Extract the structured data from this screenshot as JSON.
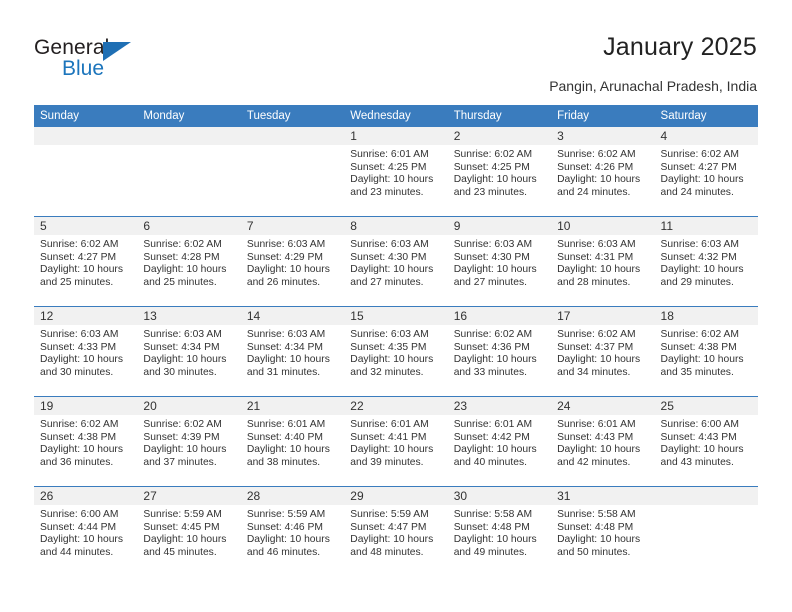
{
  "brand": {
    "name_top": "General",
    "name_bottom": "Blue",
    "accent_color": "#1c75bc",
    "triangle_color": "#1f6fb4"
  },
  "header": {
    "title": "January 2025",
    "subtitle": "Pangin, Arunachal Pradesh, India"
  },
  "calendar": {
    "header_bg": "#3a7cbe",
    "daynum_bg": "#f1f1f1",
    "weekdays": [
      "Sunday",
      "Monday",
      "Tuesday",
      "Wednesday",
      "Thursday",
      "Friday",
      "Saturday"
    ],
    "weeks": [
      [
        {
          "day": "",
          "sunrise": "",
          "sunset": "",
          "daylight1": "",
          "daylight2": ""
        },
        {
          "day": "",
          "sunrise": "",
          "sunset": "",
          "daylight1": "",
          "daylight2": ""
        },
        {
          "day": "",
          "sunrise": "",
          "sunset": "",
          "daylight1": "",
          "daylight2": ""
        },
        {
          "day": "1",
          "sunrise": "Sunrise: 6:01 AM",
          "sunset": "Sunset: 4:25 PM",
          "daylight1": "Daylight: 10 hours",
          "daylight2": "and 23 minutes."
        },
        {
          "day": "2",
          "sunrise": "Sunrise: 6:02 AM",
          "sunset": "Sunset: 4:25 PM",
          "daylight1": "Daylight: 10 hours",
          "daylight2": "and 23 minutes."
        },
        {
          "day": "3",
          "sunrise": "Sunrise: 6:02 AM",
          "sunset": "Sunset: 4:26 PM",
          "daylight1": "Daylight: 10 hours",
          "daylight2": "and 24 minutes."
        },
        {
          "day": "4",
          "sunrise": "Sunrise: 6:02 AM",
          "sunset": "Sunset: 4:27 PM",
          "daylight1": "Daylight: 10 hours",
          "daylight2": "and 24 minutes."
        }
      ],
      [
        {
          "day": "5",
          "sunrise": "Sunrise: 6:02 AM",
          "sunset": "Sunset: 4:27 PM",
          "daylight1": "Daylight: 10 hours",
          "daylight2": "and 25 minutes."
        },
        {
          "day": "6",
          "sunrise": "Sunrise: 6:02 AM",
          "sunset": "Sunset: 4:28 PM",
          "daylight1": "Daylight: 10 hours",
          "daylight2": "and 25 minutes."
        },
        {
          "day": "7",
          "sunrise": "Sunrise: 6:03 AM",
          "sunset": "Sunset: 4:29 PM",
          "daylight1": "Daylight: 10 hours",
          "daylight2": "and 26 minutes."
        },
        {
          "day": "8",
          "sunrise": "Sunrise: 6:03 AM",
          "sunset": "Sunset: 4:30 PM",
          "daylight1": "Daylight: 10 hours",
          "daylight2": "and 27 minutes."
        },
        {
          "day": "9",
          "sunrise": "Sunrise: 6:03 AM",
          "sunset": "Sunset: 4:30 PM",
          "daylight1": "Daylight: 10 hours",
          "daylight2": "and 27 minutes."
        },
        {
          "day": "10",
          "sunrise": "Sunrise: 6:03 AM",
          "sunset": "Sunset: 4:31 PM",
          "daylight1": "Daylight: 10 hours",
          "daylight2": "and 28 minutes."
        },
        {
          "day": "11",
          "sunrise": "Sunrise: 6:03 AM",
          "sunset": "Sunset: 4:32 PM",
          "daylight1": "Daylight: 10 hours",
          "daylight2": "and 29 minutes."
        }
      ],
      [
        {
          "day": "12",
          "sunrise": "Sunrise: 6:03 AM",
          "sunset": "Sunset: 4:33 PM",
          "daylight1": "Daylight: 10 hours",
          "daylight2": "and 30 minutes."
        },
        {
          "day": "13",
          "sunrise": "Sunrise: 6:03 AM",
          "sunset": "Sunset: 4:34 PM",
          "daylight1": "Daylight: 10 hours",
          "daylight2": "and 30 minutes."
        },
        {
          "day": "14",
          "sunrise": "Sunrise: 6:03 AM",
          "sunset": "Sunset: 4:34 PM",
          "daylight1": "Daylight: 10 hours",
          "daylight2": "and 31 minutes."
        },
        {
          "day": "15",
          "sunrise": "Sunrise: 6:03 AM",
          "sunset": "Sunset: 4:35 PM",
          "daylight1": "Daylight: 10 hours",
          "daylight2": "and 32 minutes."
        },
        {
          "day": "16",
          "sunrise": "Sunrise: 6:02 AM",
          "sunset": "Sunset: 4:36 PM",
          "daylight1": "Daylight: 10 hours",
          "daylight2": "and 33 minutes."
        },
        {
          "day": "17",
          "sunrise": "Sunrise: 6:02 AM",
          "sunset": "Sunset: 4:37 PM",
          "daylight1": "Daylight: 10 hours",
          "daylight2": "and 34 minutes."
        },
        {
          "day": "18",
          "sunrise": "Sunrise: 6:02 AM",
          "sunset": "Sunset: 4:38 PM",
          "daylight1": "Daylight: 10 hours",
          "daylight2": "and 35 minutes."
        }
      ],
      [
        {
          "day": "19",
          "sunrise": "Sunrise: 6:02 AM",
          "sunset": "Sunset: 4:38 PM",
          "daylight1": "Daylight: 10 hours",
          "daylight2": "and 36 minutes."
        },
        {
          "day": "20",
          "sunrise": "Sunrise: 6:02 AM",
          "sunset": "Sunset: 4:39 PM",
          "daylight1": "Daylight: 10 hours",
          "daylight2": "and 37 minutes."
        },
        {
          "day": "21",
          "sunrise": "Sunrise: 6:01 AM",
          "sunset": "Sunset: 4:40 PM",
          "daylight1": "Daylight: 10 hours",
          "daylight2": "and 38 minutes."
        },
        {
          "day": "22",
          "sunrise": "Sunrise: 6:01 AM",
          "sunset": "Sunset: 4:41 PM",
          "daylight1": "Daylight: 10 hours",
          "daylight2": "and 39 minutes."
        },
        {
          "day": "23",
          "sunrise": "Sunrise: 6:01 AM",
          "sunset": "Sunset: 4:42 PM",
          "daylight1": "Daylight: 10 hours",
          "daylight2": "and 40 minutes."
        },
        {
          "day": "24",
          "sunrise": "Sunrise: 6:01 AM",
          "sunset": "Sunset: 4:43 PM",
          "daylight1": "Daylight: 10 hours",
          "daylight2": "and 42 minutes."
        },
        {
          "day": "25",
          "sunrise": "Sunrise: 6:00 AM",
          "sunset": "Sunset: 4:43 PM",
          "daylight1": "Daylight: 10 hours",
          "daylight2": "and 43 minutes."
        }
      ],
      [
        {
          "day": "26",
          "sunrise": "Sunrise: 6:00 AM",
          "sunset": "Sunset: 4:44 PM",
          "daylight1": "Daylight: 10 hours",
          "daylight2": "and 44 minutes."
        },
        {
          "day": "27",
          "sunrise": "Sunrise: 5:59 AM",
          "sunset": "Sunset: 4:45 PM",
          "daylight1": "Daylight: 10 hours",
          "daylight2": "and 45 minutes."
        },
        {
          "day": "28",
          "sunrise": "Sunrise: 5:59 AM",
          "sunset": "Sunset: 4:46 PM",
          "daylight1": "Daylight: 10 hours",
          "daylight2": "and 46 minutes."
        },
        {
          "day": "29",
          "sunrise": "Sunrise: 5:59 AM",
          "sunset": "Sunset: 4:47 PM",
          "daylight1": "Daylight: 10 hours",
          "daylight2": "and 48 minutes."
        },
        {
          "day": "30",
          "sunrise": "Sunrise: 5:58 AM",
          "sunset": "Sunset: 4:48 PM",
          "daylight1": "Daylight: 10 hours",
          "daylight2": "and 49 minutes."
        },
        {
          "day": "31",
          "sunrise": "Sunrise: 5:58 AM",
          "sunset": "Sunset: 4:48 PM",
          "daylight1": "Daylight: 10 hours",
          "daylight2": "and 50 minutes."
        },
        {
          "day": "",
          "sunrise": "",
          "sunset": "",
          "daylight1": "",
          "daylight2": ""
        }
      ]
    ]
  }
}
